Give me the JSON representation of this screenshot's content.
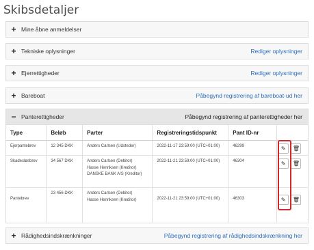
{
  "page_title": "Skibsdetaljer",
  "panels": [
    {
      "label": "Mine åbne anmeldelser",
      "link": ""
    },
    {
      "label": "Tekniske oplysninger",
      "link": "Rediger oplysninger"
    },
    {
      "label": "Ejerrettigheder",
      "link": "Rediger oplysninger"
    },
    {
      "label": "Bareboat",
      "link": "Påbegynd registrering af bareboat-ud her"
    },
    {
      "label": "Panterettigheder",
      "link": "Påbegynd registrering af panterettigheder her"
    },
    {
      "label": "Rådighedsindskrænkninger",
      "link": "Påbegynd registrering af rådighedsindskrænkning her"
    }
  ],
  "table": {
    "headers": [
      "Type",
      "Beløb",
      "Parter",
      "Registreringstidspunkt",
      "Pant ID-nr",
      ""
    ],
    "rows": [
      {
        "type": "Ejerpantebrev",
        "amount": "12 345 DKK",
        "parties": [
          "Anders Carlsen (Udsteder)"
        ],
        "timestamp": "2022-11-17 23:59:00 (UTC+01:00)",
        "id": "46299"
      },
      {
        "type": "Skadesløsbrev",
        "amount": "34 567 DKK",
        "parties": [
          "Anders Carlsen (Debitor)",
          "Hasse Henriksen (Kreditor)",
          "DANSKE BANK A/S (Kreditor)"
        ],
        "timestamp": "2022-11-21 23:59:00 (UTC+01:00)",
        "id": "46304"
      },
      {
        "type": "Pantebrev",
        "amount": "23 456 DKK",
        "parties": [
          "Anders Carlsen (Debitor)",
          "Hasse Henriksen (Kreditor)"
        ],
        "timestamp": "2022-11-21 23:59:00 (UTC+01:00)",
        "id": "46303"
      }
    ]
  },
  "icons": {
    "edit": "pencil-icon",
    "delete": "trash-icon"
  },
  "colors": {
    "link": "#2a6ebb",
    "highlight": "#d4262c"
  }
}
